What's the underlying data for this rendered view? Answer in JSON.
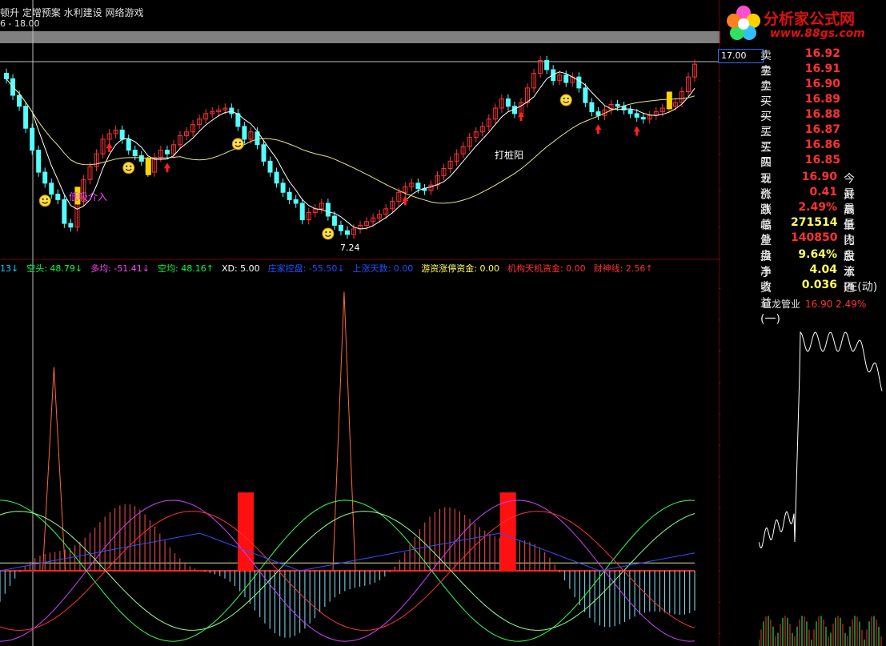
{
  "header": {
    "name_line": "顿升 定增预案 水利建设 网络游戏",
    "range_text": "6 - 18.00"
  },
  "logo": {
    "text": "分析家公式网",
    "url": "www.88gs.com"
  },
  "price_tag": "17.00",
  "annotations": {
    "low_entry": "低吸介入",
    "pile_yang": "打桩阳",
    "low_price": "7.24",
    "cash_mark": "$"
  },
  "legend": [
    {
      "text": "13↓",
      "color": "#00d0ff"
    },
    {
      "text": "空头: 48.79↓",
      "color": "#00ff40"
    },
    {
      "text": "多均: -51.41↓",
      "color": "#ff40ff"
    },
    {
      "text": "空均: 48.16↑",
      "color": "#00ff40"
    },
    {
      "text": "XD: 5.00",
      "color": "#ffffff"
    },
    {
      "text": "庄家控盘: -55.50↓",
      "color": "#2050ff"
    },
    {
      "text": "上涨天数: 0.00",
      "color": "#2050ff"
    },
    {
      "text": "游资涨停资金: 0.00",
      "color": "#ffff60"
    },
    {
      "text": "机构天机资金: 0.00",
      "color": "#ff3030"
    },
    {
      "text": "财神线: 2.56↑",
      "color": "#ff3030"
    }
  ],
  "order_book": [
    {
      "label": "卖三",
      "value": "16.92"
    },
    {
      "label": "卖二",
      "value": "16.91"
    },
    {
      "label": "卖一",
      "value": "16.90"
    },
    {
      "label": "买一",
      "value": "16.89"
    },
    {
      "label": "买二",
      "value": "16.88"
    },
    {
      "label": "买三",
      "value": "16.87"
    },
    {
      "label": "买四",
      "value": "16.86"
    },
    {
      "label": "买五",
      "value": "16.85"
    }
  ],
  "stats": [
    {
      "label": "现价",
      "value": "16.90",
      "label2": "今开",
      "color": "#ff3232"
    },
    {
      "label": "涨跌",
      "value": "0.41",
      "label2": "最高",
      "color": "#ff3232"
    },
    {
      "label": "涨幅",
      "value": "2.49%",
      "label2": "最低",
      "color": "#ff3232"
    },
    {
      "label": "总量",
      "value": "271514",
      "label2": "量比",
      "color": "#ffff60"
    },
    {
      "label": "外盘",
      "value": "140850",
      "label2": "内盘",
      "color": "#ff3232"
    },
    {
      "label": "换手",
      "value": "9.64%",
      "label2": "股本",
      "color": "#ffff60"
    },
    {
      "label": "净资",
      "value": "4.04",
      "label2": "流通",
      "color": "#ffff60"
    },
    {
      "label": "收益(一)",
      "value": "0.036",
      "label2": "PE(动)",
      "color": "#ffff60"
    }
  ],
  "mini_chart": {
    "name": "巨龙管业",
    "price": "16.90 2.49%"
  },
  "chart_data": [
    {
      "type": "candlestick",
      "y_ticks": [
        "8.00",
        "10.00",
        "12.00",
        "14.00",
        "16.00"
      ],
      "ylim": [
        6.5,
        18.0
      ],
      "closes": [
        16.1,
        15.2,
        14.6,
        13.4,
        12.2,
        11.0,
        10.4,
        9.8,
        9.5,
        8.2,
        8.0,
        9.4,
        10.6,
        11.3,
        12.0,
        12.8,
        13.1,
        13.3,
        12.8,
        12.2,
        11.9,
        11.6,
        11.0,
        11.8,
        12.2,
        12.0,
        12.5,
        13.0,
        13.2,
        13.6,
        13.9,
        14.2,
        14.3,
        14.4,
        14.5,
        14.2,
        13.5,
        12.8,
        13.2,
        12.5,
        11.6,
        11.0,
        10.4,
        9.9,
        9.5,
        9.3,
        8.4,
        8.8,
        9.0,
        9.3,
        8.6,
        8.1,
        7.8,
        7.6,
        7.9,
        8.1,
        8.3,
        8.5,
        8.7,
        9.0,
        9.4,
        9.9,
        10.2,
        10.4,
        10.1,
        10.0,
        10.3,
        10.8,
        11.2,
        11.6,
        12.0,
        12.4,
        12.9,
        13.2,
        13.5,
        13.9,
        14.5,
        15.0,
        14.6,
        14.2,
        14.8,
        15.6,
        16.4,
        17.1,
        16.6,
        16.0,
        16.3,
        15.9,
        16.2,
        15.6,
        14.8,
        14.3,
        14.1,
        14.4,
        14.7,
        14.6,
        14.4,
        14.2,
        14.0,
        13.9,
        14.1,
        14.3,
        14.5,
        14.6,
        14.8,
        15.4,
        16.2,
        16.9
      ]
    },
    {
      "type": "line",
      "y_ticks": [
        "180.0",
        "160.0",
        "140.0",
        "120.0",
        "100.0",
        "80.00",
        "60.00",
        "40.00",
        "20.00",
        "0.00",
        "-20.00",
        "-40.00"
      ],
      "ylim": [
        -48,
        188
      ],
      "red_bars_at": [
        29,
        61
      ],
      "red_bar_value": 50,
      "spikes": [
        {
          "x": 8,
          "value": 130
        },
        {
          "x": 51,
          "value": 178
        }
      ]
    }
  ]
}
